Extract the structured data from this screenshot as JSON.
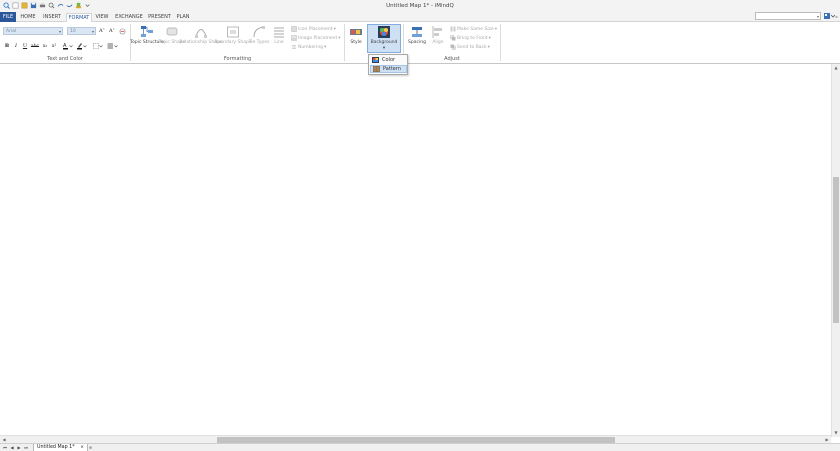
{
  "window": {
    "title": "Untitled Map 1* - iMindQ",
    "quick_access": [
      "new-icon",
      "open-icon",
      "save-icon",
      "print-icon",
      "preview-icon",
      "undo-icon",
      "redo-icon",
      "brush-icon",
      "customize-icon"
    ]
  },
  "menu": {
    "tabs": [
      {
        "label": "FILE",
        "state": "file"
      },
      {
        "label": "HOME",
        "state": "normal"
      },
      {
        "label": "INSERT",
        "state": "normal"
      },
      {
        "label": "FORMAT",
        "state": "active"
      },
      {
        "label": "VIEW",
        "state": "normal"
      },
      {
        "label": "EXCHANGE",
        "state": "normal"
      },
      {
        "label": "PRESENT",
        "state": "normal"
      },
      {
        "label": "PLAN",
        "state": "normal"
      }
    ],
    "search": {
      "value": "",
      "placeholder": ""
    }
  },
  "ribbon": {
    "text_color": {
      "label": "Text and Color",
      "font": {
        "value": "Arial"
      },
      "size": {
        "value": "10"
      },
      "buttons": [
        "B",
        "I",
        "U",
        "abc",
        "x₂",
        "x²"
      ]
    },
    "formatting": {
      "label": "Formatting",
      "topic_structure": "Topic Structure",
      "topic_shape": "Topic Shape",
      "relationship_shape": "Relationship Shape",
      "boundary_shape": "Boundary Shape",
      "tie_types": "Tie Types",
      "line": "Line",
      "icon_placement": "Icon Placement",
      "image_placement": "Image Placement",
      "numbering": "Numbering"
    },
    "style_group": {
      "style": "Style",
      "background": "Background"
    },
    "adjust": {
      "label": "Adjust",
      "spacing": "Spacing",
      "align": "Align",
      "make_same_size": "Make Same Size",
      "bring_to_front": "Bring to Front",
      "send_to_back": "Send to Back"
    }
  },
  "background_menu": {
    "items": [
      {
        "label": "Color",
        "hover": false
      },
      {
        "label": "Pattern",
        "hover": true
      }
    ]
  },
  "sheets": {
    "tabs": [
      {
        "label": "Untitled Map 1*",
        "close": "×"
      }
    ]
  },
  "colors": {
    "file_tab": "#2b579a",
    "pressed": "#cde0f4",
    "scroll_thumb": "#c2c2c2"
  }
}
